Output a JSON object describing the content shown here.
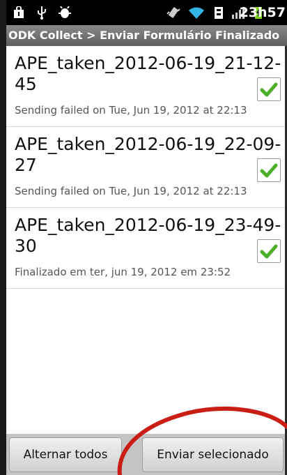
{
  "status_bar": {
    "time": "23h57",
    "icons": [
      "shopping-bag-icon",
      "usb-icon",
      "android-debug-icon",
      "vibrate-icon",
      "wifi-icon",
      "battery-charging-icon",
      "signal-icon",
      "battery-icon"
    ]
  },
  "title_bar": {
    "title": "ODK Collect > Enviar Formulário Finalizado"
  },
  "forms": [
    {
      "title": "APE_taken_2012-06-19_21-12-45",
      "subtitle": "Sending failed on Tue, Jun 19, 2012 at 22:13",
      "checked": true
    },
    {
      "title": "APE_taken_2012-06-19_22-09-27",
      "subtitle": "Sending failed on Tue, Jun 19, 2012 at 22:13",
      "checked": true
    },
    {
      "title": "APE_taken_2012-06-19_23-49-30",
      "subtitle": "Finalizado em ter, jun 19, 2012 em 23:52",
      "checked": true
    }
  ],
  "buttons": {
    "toggle_all": "Alternar todos",
    "send_selected": "Enviar selecionado"
  },
  "colors": {
    "check_green": "#4caf2a",
    "annotation_red": "#c81e14"
  }
}
